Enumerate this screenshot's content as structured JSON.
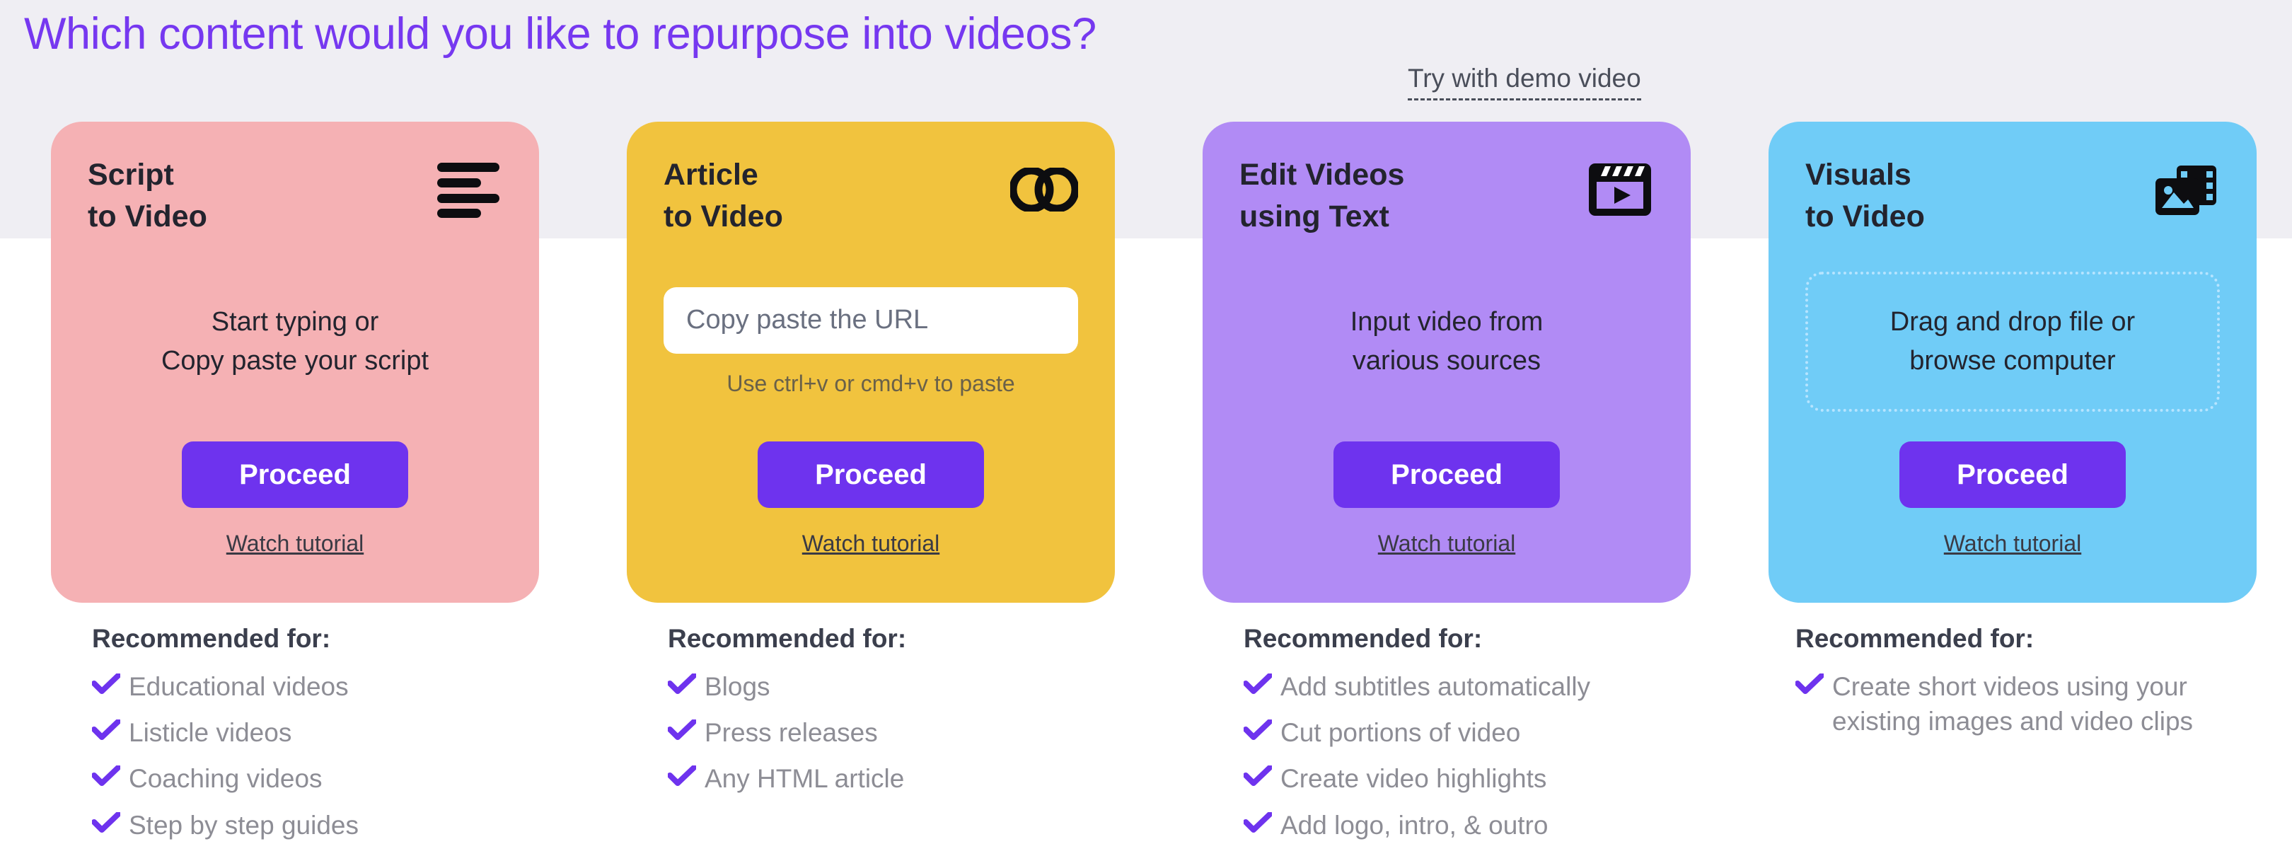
{
  "page": {
    "title": "Which content would you like to repurpose into videos?",
    "title_color": "#7638f0",
    "background_top": "#efeef3",
    "background_bottom": "#ffffff"
  },
  "demo": {
    "label": "Try with demo video"
  },
  "common": {
    "proceed_label": "Proceed",
    "watch_label": "Watch tutorial",
    "recommended_label": "Recommended for:",
    "proceed_color": "#6e33ee",
    "check_color": "#6e33ee"
  },
  "cards": [
    {
      "title": "Script\nto Video",
      "icon": "text-lines-icon",
      "color": "#f5b1b4",
      "body_text": "Start typing or\nCopy paste your script",
      "proceed_label": "Proceed",
      "watch_label": "Watch tutorial",
      "recommended_label": "Recommended for:",
      "recommended": [
        "Educational videos",
        "Listicle videos",
        "Coaching videos",
        "Step by step guides"
      ]
    },
    {
      "title": "Article\nto Video",
      "icon": "link-chain-icon",
      "color": "#f1c33e",
      "input_placeholder": "Copy paste the URL",
      "input_value": "",
      "hint": "Use ctrl+v or cmd+v to paste",
      "proceed_label": "Proceed",
      "watch_label": "Watch tutorial",
      "recommended_label": "Recommended for:",
      "recommended": [
        "Blogs",
        "Press releases",
        "Any HTML article"
      ]
    },
    {
      "title": "Edit Videos\nusing Text",
      "icon": "clapperboard-play-icon",
      "color": "#b18bf5",
      "body_text": "Input video from\nvarious sources",
      "proceed_label": "Proceed",
      "watch_label": "Watch tutorial",
      "recommended_label": "Recommended for:",
      "recommended": [
        "Add subtitles automatically",
        "Cut portions of video",
        "Create video highlights",
        "Add logo, intro, & outro"
      ]
    },
    {
      "title": "Visuals\nto Video",
      "icon": "image-filmstrip-icon",
      "color": "#70ccf7",
      "dropzone_text": "Drag and drop file or\nbrowse computer",
      "proceed_label": "Proceed",
      "watch_label": "Watch tutorial",
      "recommended_label": "Recommended for:",
      "recommended": [
        "Create short videos using your existing images and video clips"
      ]
    }
  ]
}
